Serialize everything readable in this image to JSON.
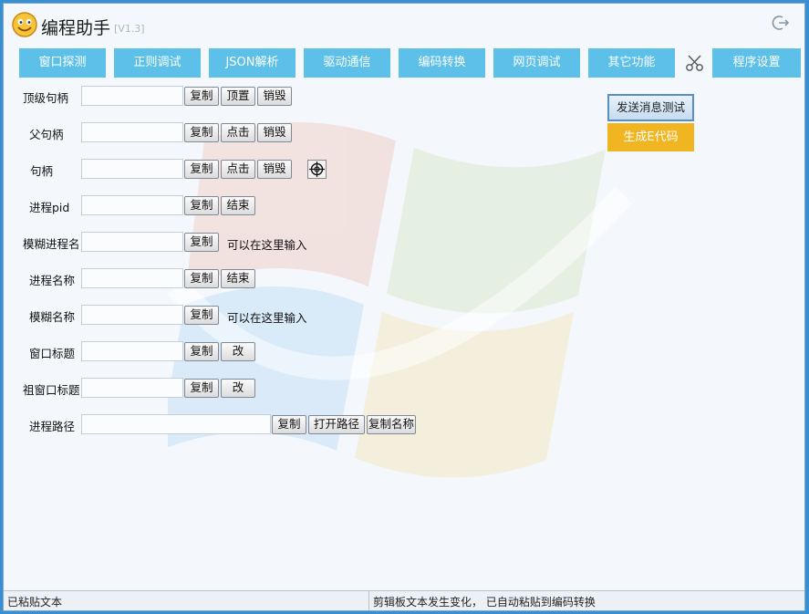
{
  "app": {
    "title": "编程助手",
    "version": "[V1.3]"
  },
  "tabs": [
    {
      "label": "窗口探测"
    },
    {
      "label": "正则调试"
    },
    {
      "label": "JSON解析"
    },
    {
      "label": "驱动通信"
    },
    {
      "label": "编码转换"
    },
    {
      "label": "网页调试"
    },
    {
      "label": "其它功能"
    },
    {
      "label": "程序设置"
    }
  ],
  "form": {
    "top_handle": {
      "label": "顶级句柄",
      "value": "",
      "copy": "复制",
      "action1": "顶置",
      "action2": "销毁"
    },
    "parent_handle": {
      "label": "父句柄",
      "value": "",
      "copy": "复制",
      "action1": "点击",
      "action2": "销毁"
    },
    "handle": {
      "label": "句柄",
      "value": "",
      "copy": "复制",
      "action1": "点击",
      "action2": "销毁"
    },
    "pid": {
      "label": "进程pid",
      "value": "",
      "copy": "复制",
      "action1": "结束"
    },
    "fuzzy_process": {
      "label": "模糊进程名",
      "value": "",
      "copy": "复制",
      "hint": "可以在这里输入"
    },
    "process_name": {
      "label": "进程名称",
      "value": "",
      "copy": "复制",
      "action1": "结束"
    },
    "fuzzy_name": {
      "label": "模糊名称",
      "value": "",
      "copy": "复制",
      "hint": "可以在这里输入"
    },
    "window_title": {
      "label": "窗口标题",
      "value": "",
      "copy": "复制",
      "action1": "改"
    },
    "root_title": {
      "label": "祖窗口标题",
      "value": "",
      "copy": "复制",
      "action1": "改"
    },
    "process_path": {
      "label": "进程路径",
      "value": "",
      "copy": "复制",
      "open_path": "打开路径",
      "copy_name": "复制名称"
    }
  },
  "side": {
    "send_test": "发送消息测试",
    "generate_e": "生成E代码"
  },
  "status": {
    "left": "已粘贴文本",
    "right": "剪辑板文本发生变化， 已自动粘贴到编码转换"
  },
  "colors": {
    "tab_bg": "#5cc0e8",
    "accent_orange": "#f0b520"
  }
}
